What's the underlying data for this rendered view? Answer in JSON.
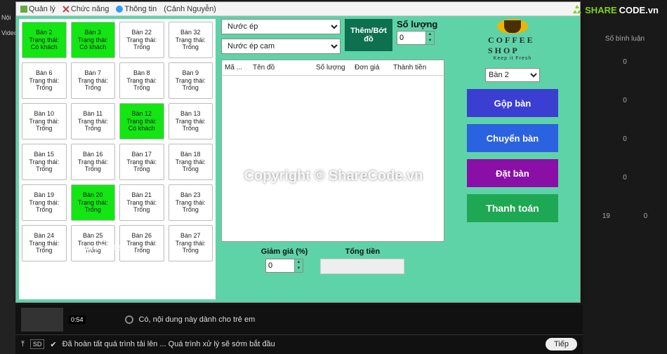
{
  "menubar": {
    "m1": "Quản lý",
    "m2": "Chức năng",
    "m3": "Thông tin",
    "user": "(Cảnh Nguyễn)"
  },
  "tables": [
    {
      "n": "Bàn 2",
      "s": "Có khách",
      "g": true
    },
    {
      "n": "Bàn 3",
      "s": "Có khách",
      "g": true
    },
    {
      "n": "Bàn 22",
      "s": "Trống"
    },
    {
      "n": "Bàn 32",
      "s": "Trống"
    },
    {
      "n": "Bàn 6",
      "s": "Trống"
    },
    {
      "n": "Bàn 7",
      "s": "Trống"
    },
    {
      "n": "Bàn 8",
      "s": "Trống"
    },
    {
      "n": "Bàn 9",
      "s": "Trống"
    },
    {
      "n": "Bàn 10",
      "s": "Trống"
    },
    {
      "n": "Bàn 11",
      "s": "Trống"
    },
    {
      "n": "Bàn 12",
      "s": "Có khách",
      "g": true
    },
    {
      "n": "Bàn 13",
      "s": "Trống"
    },
    {
      "n": "Bàn 15",
      "s": "Trống"
    },
    {
      "n": "Bàn 16",
      "s": "Trống"
    },
    {
      "n": "Bàn 17",
      "s": "Trống"
    },
    {
      "n": "Bàn 18",
      "s": "Trống"
    },
    {
      "n": "Bàn 19",
      "s": "Trống"
    },
    {
      "n": "Bàn 20",
      "s": "Trống",
      "g": true
    },
    {
      "n": "Bàn 21",
      "s": "Trống"
    },
    {
      "n": "Bàn 23",
      "s": "Trống"
    },
    {
      "n": "Bàn 24",
      "s": "Trống"
    },
    {
      "n": "Bàn 25",
      "s": "Trống"
    },
    {
      "n": "Bàn 26",
      "s": "Trống"
    },
    {
      "n": "Bàn 27",
      "s": "Trống"
    }
  ],
  "status_label": "Trạng thái:",
  "category_select": "Nước ép",
  "product_select": "Nước ép cam",
  "add_btn_l1": "Thêm/Bớt",
  "add_btn_l2": "đồ",
  "qty_label": "Số lượng",
  "qty_value": "0",
  "cols": {
    "c1": "Mã ...",
    "c2": "Tên đồ",
    "c3": "Số lượng",
    "c4": "Đơn giá",
    "c5": "Thành tiền"
  },
  "discount_label": "Giảm giá (%)",
  "discount_value": "0",
  "total_label": "Tổng tiền",
  "brand": "COFFEE SHOP",
  "brand2": "Keep it Fresh",
  "table_select": "Bàn 2",
  "btn_merge": "Gộp bàn",
  "btn_move": "Chuyển bàn",
  "btn_reserve": "Đặt bàn",
  "btn_pay": "Thanh toán",
  "wm_center": "Copyright © ShareCode.vn",
  "wm_small": "ShareCode.vn",
  "wm_logo_a": "SHARE",
  "wm_logo_b": "CODE.vn",
  "yt": {
    "radio": "Có, nội dung này dành cho trẻ em",
    "sd": "SD",
    "proc": "Đã hoàn tất quá trình tải lên ... Quá trình xử lý sẽ sớm bắt đầu",
    "next": "Tiếp",
    "dur": "0:54"
  },
  "left": {
    "l1": "Nội",
    "l2": "Video"
  },
  "right": {
    "h": "Số bình luận",
    "v0": "0",
    "v1": "0",
    "v2": "0",
    "v3": "0",
    "v19": "19",
    "v4": "0"
  }
}
